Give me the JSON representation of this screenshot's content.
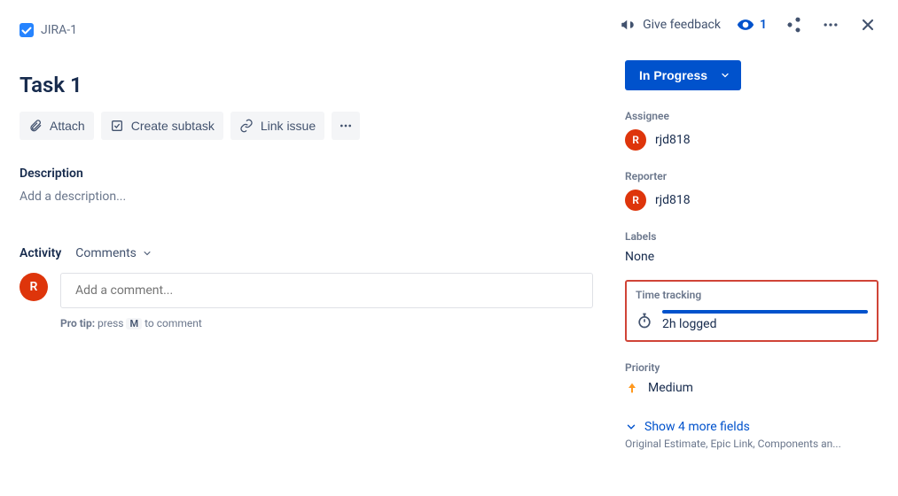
{
  "breadcrumb": {
    "issue_key": "JIRA-1"
  },
  "header_actions": {
    "feedback_label": "Give feedback",
    "watch_count": "1"
  },
  "title": "Task 1",
  "toolbar": {
    "attach_label": "Attach",
    "subtask_label": "Create subtask",
    "link_label": "Link issue"
  },
  "description": {
    "heading": "Description",
    "placeholder": "Add a description..."
  },
  "activity": {
    "heading": "Activity",
    "filter_label": "Comments",
    "comment_placeholder": "Add a comment...",
    "avatar_initial": "R",
    "protip_prefix": "Pro tip:",
    "protip_press": " press ",
    "protip_key": "M",
    "protip_suffix": " to comment"
  },
  "sidebar": {
    "status_label": "In Progress",
    "assignee": {
      "label": "Assignee",
      "initial": "R",
      "name": "rjd818"
    },
    "reporter": {
      "label": "Reporter",
      "initial": "R",
      "name": "rjd818"
    },
    "labels": {
      "label": "Labels",
      "value": "None"
    },
    "time_tracking": {
      "label": "Time tracking",
      "value": "2h logged"
    },
    "priority": {
      "label": "Priority",
      "value": "Medium"
    },
    "show_more": {
      "label": "Show 4 more fields",
      "hint": "Original Estimate, Epic Link, Components an..."
    }
  }
}
